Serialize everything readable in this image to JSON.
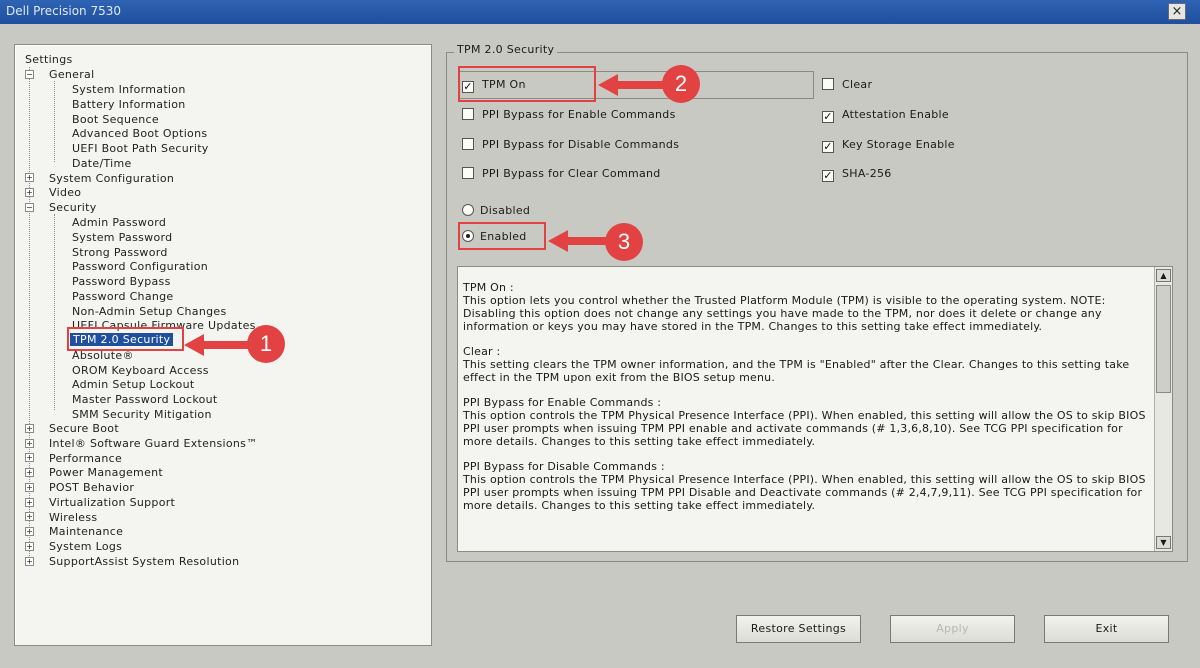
{
  "window": {
    "title": "Dell Precision 7530",
    "close_glyph": "×"
  },
  "tree": {
    "root": "Settings",
    "general": {
      "label": "General",
      "expander": "−",
      "children": [
        "System Information",
        "Battery Information",
        "Boot Sequence",
        "Advanced Boot Options",
        "UEFI Boot Path Security",
        "Date/Time"
      ]
    },
    "system_configuration": {
      "label": "System Configuration",
      "expander": "+"
    },
    "video": {
      "label": "Video",
      "expander": "+"
    },
    "security": {
      "label": "Security",
      "expander": "−",
      "children": [
        "Admin Password",
        "System Password",
        "Strong Password",
        "Password Configuration",
        "Password Bypass",
        "Password Change",
        "Non-Admin Setup Changes",
        "UEFI Capsule Firmware Updates",
        "TPM 2.0 Security",
        "Absolute®",
        "OROM Keyboard Access",
        "Admin Setup Lockout",
        "Master Password Lockout",
        "SMM Security Mitigation"
      ]
    },
    "collapsed": [
      {
        "label": "Secure Boot",
        "expander": "+"
      },
      {
        "label": "Intel® Software Guard Extensions™",
        "expander": "+"
      },
      {
        "label": "Performance",
        "expander": "+"
      },
      {
        "label": "Power Management",
        "expander": "+"
      },
      {
        "label": "POST Behavior",
        "expander": "+"
      },
      {
        "label": "Virtualization Support",
        "expander": "+"
      },
      {
        "label": "Wireless",
        "expander": "+"
      },
      {
        "label": "Maintenance",
        "expander": "+"
      },
      {
        "label": "System Logs",
        "expander": "+"
      },
      {
        "label": "SupportAssist System Resolution",
        "expander": "+"
      }
    ]
  },
  "panel": {
    "group_title": "TPM 2.0 Security",
    "checkboxes_left": [
      {
        "label": "TPM On",
        "checked": true
      },
      {
        "label": "PPI Bypass for Enable Commands",
        "checked": false
      },
      {
        "label": "PPI Bypass for Disable Commands",
        "checked": false
      },
      {
        "label": "PPI Bypass for Clear Command",
        "checked": false
      }
    ],
    "checkboxes_right": [
      {
        "label": "Clear",
        "checked": false
      },
      {
        "label": "Attestation Enable",
        "checked": true
      },
      {
        "label": "Key Storage Enable",
        "checked": true
      },
      {
        "label": "SHA-256",
        "checked": true
      }
    ],
    "check_glyph": "✓",
    "radios": [
      {
        "label": "Disabled",
        "selected": false
      },
      {
        "label": "Enabled",
        "selected": true
      }
    ]
  },
  "help": {
    "paragraphs": [
      "TPM On :\nThis option lets you control whether the Trusted Platform Module (TPM) is visible to the operating system. NOTE: Disabling this option does not change any settings you have made to the TPM, nor does it delete or change any information or keys you may have stored in the TPM.  Changes to this setting take effect immediately.",
      "Clear :\nThis setting clears the TPM owner information, and the TPM is \"Enabled\" after the Clear.  Changes to this setting take effect in the TPM upon exit from the BIOS setup menu.",
      "PPI Bypass for Enable Commands :\nThis option controls the TPM Physical Presence Interface (PPI). When enabled, this setting will allow the OS to skip BIOS PPI user prompts when issuing TPM PPI enable and activate commands (# 1,3,6,8,10).  See TCG PPI specification for more details. Changes to this setting take effect immediately.",
      "PPI Bypass for Disable Commands :\nThis option controls the TPM Physical Presence Interface (PPI). When enabled, this setting will allow the OS to skip BIOS PPI user prompts when issuing TPM PPI Disable and Deactivate commands (# 2,4,7,9,11).  See TCG PPI specification for more details.  Changes to this setting take effect immediately."
    ],
    "scroll_up": "▲",
    "scroll_down": "▼"
  },
  "buttons": {
    "restore": "Restore Settings",
    "apply": "Apply",
    "exit": "Exit"
  },
  "annotations": {
    "one": "1",
    "two": "2",
    "three": "3",
    "color": "#e24242"
  }
}
